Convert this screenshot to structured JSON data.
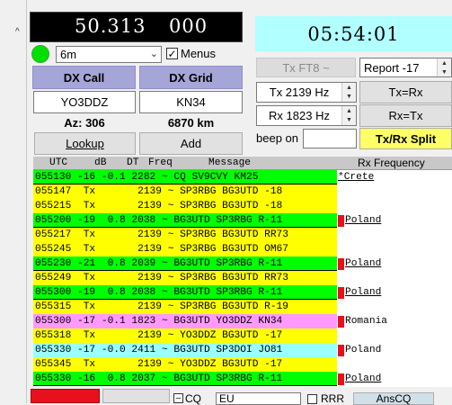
{
  "frequency": {
    "mhz": "50.313",
    "khz": "000"
  },
  "band": {
    "selected": "6m"
  },
  "menus": {
    "label": "Menus",
    "checked": true
  },
  "clock": "05:54:01",
  "dx": {
    "call_header": "DX Call",
    "grid_header": "DX Grid",
    "call_value": "YO3DDZ",
    "grid_value": "KN34",
    "az": "Az: 306",
    "distance": "6870 km",
    "lookup_label": "Lookup",
    "add_label": "Add"
  },
  "controls": {
    "tx_mode_label": "Tx FT8 ~",
    "report": "Report -17",
    "tx_freq": "Tx  2139  Hz",
    "rx_freq": "Rx  1823  Hz",
    "tx_eq_rx": "Tx=Rx",
    "rx_eq_tx": "Rx=Tx",
    "beep_label": "beep on",
    "beep_value": "",
    "split_label": "Tx/Rx Split"
  },
  "decode_header": {
    "utc": "UTC",
    "db": "dB",
    "dt": "DT",
    "freq": "Freq",
    "message": "Message",
    "rx_frequency": "Rx Frequency"
  },
  "rows": [
    {
      "text": "055130 -16 -0.1 2282 ~ CQ SV9CVY KM25",
      "country": "*Crete",
      "bg": "#00ff00",
      "flag": false,
      "ul": true
    },
    {
      "text": "055147  Tx       2139 ~ SP3RBG BG3UTD -18",
      "country": "",
      "bg": "#ffff00",
      "flag": false,
      "ul": false
    },
    {
      "text": "055215  Tx       2139 ~ SP3RBG BG3UTD -18",
      "country": "",
      "bg": "#ffff00",
      "flag": false,
      "ul": false
    },
    {
      "text": "055200 -19  0.8 2038 ~ BG3UTD SP3RBG R-11",
      "country": "Poland",
      "bg": "#00ff00",
      "flag": true,
      "ul": true
    },
    {
      "text": "055217  Tx       2139 ~ SP3RBG BG3UTD RR73",
      "country": "",
      "bg": "#ffff00",
      "flag": false,
      "ul": false
    },
    {
      "text": "055245  Tx       2139 ~ SP3RBG BG3UTD OM67",
      "country": "",
      "bg": "#ffff00",
      "flag": false,
      "ul": false
    },
    {
      "text": "055230 -21  0.8 2039 ~ BG3UTD SP3RBG R-11",
      "country": "Poland",
      "bg": "#00ff00",
      "flag": true,
      "ul": true
    },
    {
      "text": "055249  Tx       2139 ~ SP3RBG BG3UTD RR73",
      "country": "",
      "bg": "#ffff00",
      "flag": false,
      "ul": false
    },
    {
      "text": "055300 -19  0.8 2038 ~ BG3UTD SP3RBG R-11",
      "country": "Poland",
      "bg": "#00ff00",
      "flag": true,
      "ul": true
    },
    {
      "text": "055315  Tx       2139 ~ SP3RBG BG3UTD R-19",
      "country": "",
      "bg": "#ffff00",
      "flag": false,
      "ul": false
    },
    {
      "text": "055300 -17 -0.1 1823 ~ BG3UTD YO3DDZ KN34",
      "country": "Romania",
      "bg": "#ff99ff",
      "flag": true,
      "ul": false
    },
    {
      "text": "055318  Tx       2139 ~ YO3DDZ BG3UTD -17",
      "country": "",
      "bg": "#ffff00",
      "flag": false,
      "ul": false
    },
    {
      "text": "055330 -17 -0.0 2411 ~ BG3UTD SP3DOI JO81",
      "country": "Poland",
      "bg": "#99ffff",
      "flag": true,
      "ul": false
    },
    {
      "text": "055345  Tx       2139 ~ YO3DDZ BG3UTD -17",
      "country": "",
      "bg": "#ffff00",
      "flag": false,
      "ul": false
    },
    {
      "text": "055330 -16  0.8 2037 ~ BG3UTD SP3RBG R-11",
      "country": "Poland",
      "bg": "#00ff00",
      "flag": true,
      "ul": true
    }
  ],
  "bottom": {
    "co_label": "CQ",
    "eu_value": "EU",
    "rrr_label": "RRR",
    "ansco_label": "AnsCQ"
  }
}
